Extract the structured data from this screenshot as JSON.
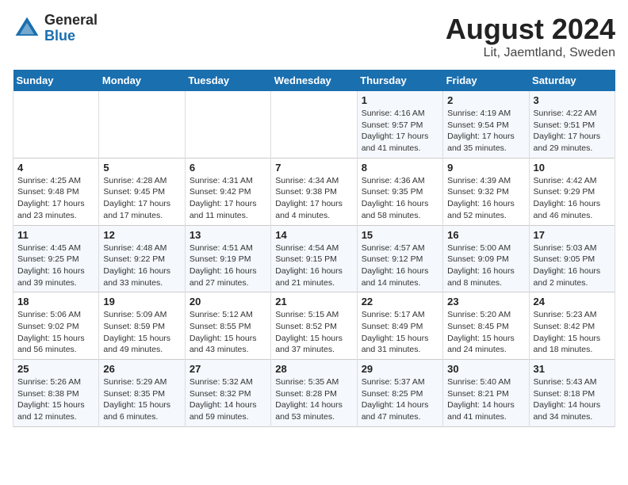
{
  "logo": {
    "general": "General",
    "blue": "Blue"
  },
  "title": "August 2024",
  "subtitle": "Lit, Jaemtland, Sweden",
  "days_of_week": [
    "Sunday",
    "Monday",
    "Tuesday",
    "Wednesday",
    "Thursday",
    "Friday",
    "Saturday"
  ],
  "weeks": [
    [
      {
        "day": "",
        "info": ""
      },
      {
        "day": "",
        "info": ""
      },
      {
        "day": "",
        "info": ""
      },
      {
        "day": "",
        "info": ""
      },
      {
        "day": "1",
        "info": "Sunrise: 4:16 AM\nSunset: 9:57 PM\nDaylight: 17 hours\nand 41 minutes."
      },
      {
        "day": "2",
        "info": "Sunrise: 4:19 AM\nSunset: 9:54 PM\nDaylight: 17 hours\nand 35 minutes."
      },
      {
        "day": "3",
        "info": "Sunrise: 4:22 AM\nSunset: 9:51 PM\nDaylight: 17 hours\nand 29 minutes."
      }
    ],
    [
      {
        "day": "4",
        "info": "Sunrise: 4:25 AM\nSunset: 9:48 PM\nDaylight: 17 hours\nand 23 minutes."
      },
      {
        "day": "5",
        "info": "Sunrise: 4:28 AM\nSunset: 9:45 PM\nDaylight: 17 hours\nand 17 minutes."
      },
      {
        "day": "6",
        "info": "Sunrise: 4:31 AM\nSunset: 9:42 PM\nDaylight: 17 hours\nand 11 minutes."
      },
      {
        "day": "7",
        "info": "Sunrise: 4:34 AM\nSunset: 9:38 PM\nDaylight: 17 hours\nand 4 minutes."
      },
      {
        "day": "8",
        "info": "Sunrise: 4:36 AM\nSunset: 9:35 PM\nDaylight: 16 hours\nand 58 minutes."
      },
      {
        "day": "9",
        "info": "Sunrise: 4:39 AM\nSunset: 9:32 PM\nDaylight: 16 hours\nand 52 minutes."
      },
      {
        "day": "10",
        "info": "Sunrise: 4:42 AM\nSunset: 9:29 PM\nDaylight: 16 hours\nand 46 minutes."
      }
    ],
    [
      {
        "day": "11",
        "info": "Sunrise: 4:45 AM\nSunset: 9:25 PM\nDaylight: 16 hours\nand 39 minutes."
      },
      {
        "day": "12",
        "info": "Sunrise: 4:48 AM\nSunset: 9:22 PM\nDaylight: 16 hours\nand 33 minutes."
      },
      {
        "day": "13",
        "info": "Sunrise: 4:51 AM\nSunset: 9:19 PM\nDaylight: 16 hours\nand 27 minutes."
      },
      {
        "day": "14",
        "info": "Sunrise: 4:54 AM\nSunset: 9:15 PM\nDaylight: 16 hours\nand 21 minutes."
      },
      {
        "day": "15",
        "info": "Sunrise: 4:57 AM\nSunset: 9:12 PM\nDaylight: 16 hours\nand 14 minutes."
      },
      {
        "day": "16",
        "info": "Sunrise: 5:00 AM\nSunset: 9:09 PM\nDaylight: 16 hours\nand 8 minutes."
      },
      {
        "day": "17",
        "info": "Sunrise: 5:03 AM\nSunset: 9:05 PM\nDaylight: 16 hours\nand 2 minutes."
      }
    ],
    [
      {
        "day": "18",
        "info": "Sunrise: 5:06 AM\nSunset: 9:02 PM\nDaylight: 15 hours\nand 56 minutes."
      },
      {
        "day": "19",
        "info": "Sunrise: 5:09 AM\nSunset: 8:59 PM\nDaylight: 15 hours\nand 49 minutes."
      },
      {
        "day": "20",
        "info": "Sunrise: 5:12 AM\nSunset: 8:55 PM\nDaylight: 15 hours\nand 43 minutes."
      },
      {
        "day": "21",
        "info": "Sunrise: 5:15 AM\nSunset: 8:52 PM\nDaylight: 15 hours\nand 37 minutes."
      },
      {
        "day": "22",
        "info": "Sunrise: 5:17 AM\nSunset: 8:49 PM\nDaylight: 15 hours\nand 31 minutes."
      },
      {
        "day": "23",
        "info": "Sunrise: 5:20 AM\nSunset: 8:45 PM\nDaylight: 15 hours\nand 24 minutes."
      },
      {
        "day": "24",
        "info": "Sunrise: 5:23 AM\nSunset: 8:42 PM\nDaylight: 15 hours\nand 18 minutes."
      }
    ],
    [
      {
        "day": "25",
        "info": "Sunrise: 5:26 AM\nSunset: 8:38 PM\nDaylight: 15 hours\nand 12 minutes."
      },
      {
        "day": "26",
        "info": "Sunrise: 5:29 AM\nSunset: 8:35 PM\nDaylight: 15 hours\nand 6 minutes."
      },
      {
        "day": "27",
        "info": "Sunrise: 5:32 AM\nSunset: 8:32 PM\nDaylight: 14 hours\nand 59 minutes."
      },
      {
        "day": "28",
        "info": "Sunrise: 5:35 AM\nSunset: 8:28 PM\nDaylight: 14 hours\nand 53 minutes."
      },
      {
        "day": "29",
        "info": "Sunrise: 5:37 AM\nSunset: 8:25 PM\nDaylight: 14 hours\nand 47 minutes."
      },
      {
        "day": "30",
        "info": "Sunrise: 5:40 AM\nSunset: 8:21 PM\nDaylight: 14 hours\nand 41 minutes."
      },
      {
        "day": "31",
        "info": "Sunrise: 5:43 AM\nSunset: 8:18 PM\nDaylight: 14 hours\nand 34 minutes."
      }
    ]
  ]
}
